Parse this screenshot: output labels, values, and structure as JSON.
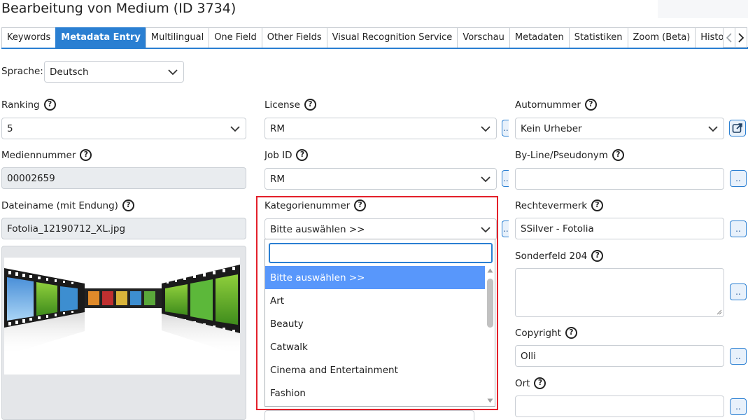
{
  "title": "Bearbeitung von Medium (ID 3734)",
  "tabs": [
    {
      "label": "Keywords"
    },
    {
      "label": "Metadata Entry"
    },
    {
      "label": "Multilingual"
    },
    {
      "label": "One Field"
    },
    {
      "label": "Other Fields"
    },
    {
      "label": "Visual Recognition Service"
    },
    {
      "label": "Vorschau"
    },
    {
      "label": "Metadaten"
    },
    {
      "label": "Statistiken"
    },
    {
      "label": "Zoom (Beta)"
    },
    {
      "label": "Histori"
    }
  ],
  "language": {
    "label": "Sprache:",
    "value": "Deutsch"
  },
  "help_glyph": "?",
  "more_glyph": "..",
  "left": {
    "ranking": {
      "label": "Ranking",
      "value": "5"
    },
    "mediennummer": {
      "label": "Mediennummer",
      "value": "00002659"
    },
    "dateiname": {
      "label": "Dateiname (mit Endung)",
      "value": "Fotolia_12190712_XL.jpg"
    }
  },
  "middle": {
    "license": {
      "label": "License",
      "value": "RM"
    },
    "jobid": {
      "label": "Job ID",
      "value": "RM"
    },
    "kategorie": {
      "label": "Kategorienummer",
      "value": "Bitte auswählen >>",
      "search_value": "",
      "options": [
        {
          "label": "Bitte auswählen >>",
          "selected": true
        },
        {
          "label": "Art"
        },
        {
          "label": "Beauty"
        },
        {
          "label": "Catwalk"
        },
        {
          "label": "Cinema and Entertainment"
        },
        {
          "label": "Fashion"
        }
      ]
    }
  },
  "right": {
    "autornummer": {
      "label": "Autornummer",
      "value": "Kein Urheber"
    },
    "byline": {
      "label": "By-Line/Pseudonym",
      "value": ""
    },
    "rechtevermerk": {
      "label": "Rechtevermerk",
      "value": "SSilver - Fotolia"
    },
    "sonderfeld": {
      "label": "Sonderfeld 204",
      "value": ""
    },
    "copyright": {
      "label": "Copyright",
      "value": "Olli"
    },
    "ort": {
      "label": "Ort",
      "value": ""
    }
  },
  "colors": {
    "accent": "#2a7fd2",
    "highlight": "#5897fb",
    "frame": "#e3202a"
  }
}
